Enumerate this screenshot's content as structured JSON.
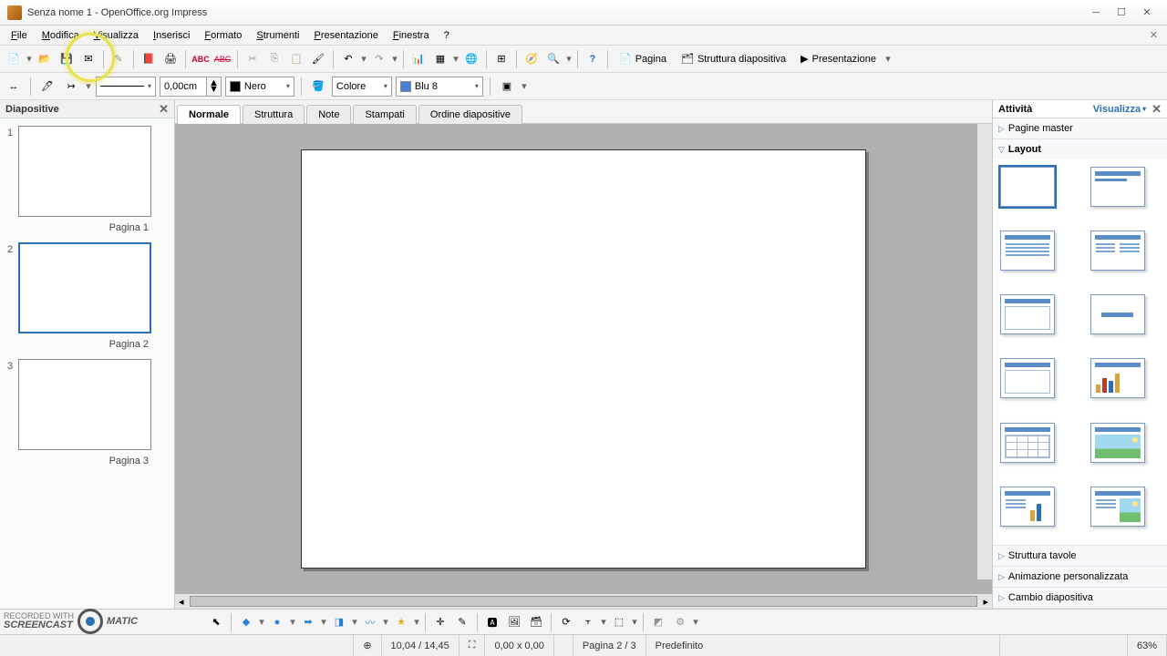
{
  "window": {
    "title": "Senza nome 1 - OpenOffice.org Impress"
  },
  "menubar": {
    "items": [
      "File",
      "Modifica",
      "Visualizza",
      "Inserisci",
      "Formato",
      "Strumenti",
      "Presentazione",
      "Finestra",
      "?"
    ]
  },
  "toolbar1": {
    "page_btn": "Pagina",
    "slide_structure_btn": "Struttura diapositiva",
    "presentation_btn": "Presentazione"
  },
  "toolbar2": {
    "line_width": "0,00cm",
    "line_color_name": "Nero",
    "line_color_hex": "#000000",
    "fill_label": "Colore",
    "fill_name": "Blu 8",
    "fill_hex": "#4a7fd6"
  },
  "slidepanel": {
    "title": "Diapositive",
    "slides": [
      {
        "num": "1",
        "label": "Pagina 1",
        "selected": false
      },
      {
        "num": "2",
        "label": "Pagina 2",
        "selected": true
      },
      {
        "num": "3",
        "label": "Pagina 3",
        "selected": false
      }
    ]
  },
  "viewtabs": {
    "items": [
      "Normale",
      "Struttura",
      "Note",
      "Stampati",
      "Ordine diapositive"
    ],
    "active": 0
  },
  "taskpanel": {
    "title": "Attività",
    "toggle": "Visualizza",
    "sections": {
      "master": "Pagine master",
      "layout": "Layout",
      "table": "Struttura tavole",
      "anim": "Animazione personalizzata",
      "trans": "Cambio diapositiva"
    }
  },
  "statusbar": {
    "coords": "10,04 / 14,45",
    "size": "0,00 x 0,00",
    "page": "Pagina 2 / 3",
    "template": "Predefinito",
    "zoom": "63%"
  },
  "watermark": {
    "small": "RECORDED WITH",
    "brand": "SCREENCAST◯MATIC"
  }
}
